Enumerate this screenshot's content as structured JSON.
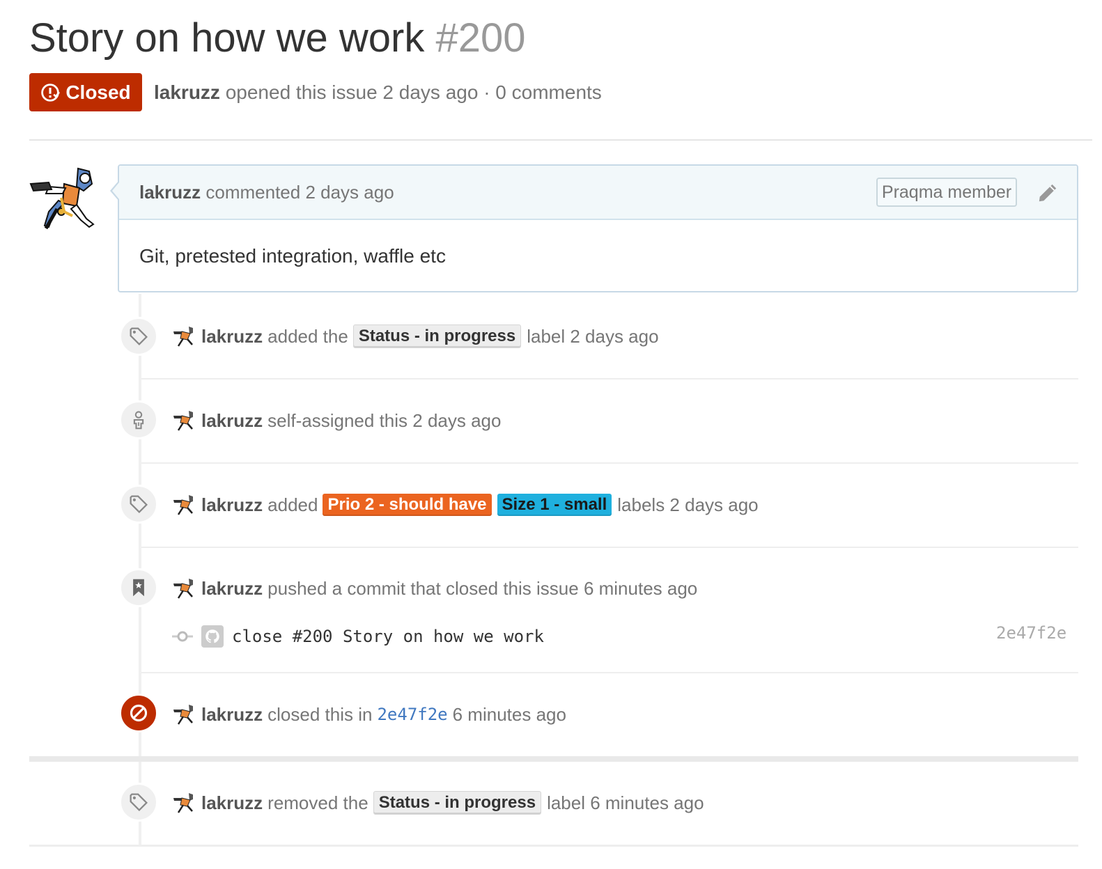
{
  "issue": {
    "title": "Story on how we work",
    "number": "#200",
    "state": "Closed",
    "author": "lakruzz",
    "opened_text": "opened this issue 2 days ago · 0 comments"
  },
  "comment": {
    "author": "lakruzz",
    "action": "commented 2 days ago",
    "role_badge": "Praqma member",
    "body": "Git, pretested integration, waffle etc"
  },
  "timeline": {
    "event1": {
      "author": "lakruzz",
      "before": "added the",
      "label": "Status - in progress",
      "after": "label 2 days ago"
    },
    "event2": {
      "author": "lakruzz",
      "text": "self-assigned this 2 days ago"
    },
    "event3": {
      "author": "lakruzz",
      "before": "added",
      "label1": "Prio 2 - should have",
      "label2": "Size 1 - small",
      "after": "labels 2 days ago"
    },
    "event4": {
      "author": "lakruzz",
      "text": "pushed a commit that closed this issue 6 minutes ago",
      "commit_message": "close #200 Story on how we work",
      "commit_sha": "2e47f2e"
    },
    "event5": {
      "author": "lakruzz",
      "before": "closed this in",
      "sha": "2e47f2e",
      "after": "6 minutes ago"
    },
    "event6": {
      "author": "lakruzz",
      "before": "removed the",
      "label": "Status - in progress",
      "after": "label 6 minutes ago"
    }
  },
  "colors": {
    "closed_red": "#bd2c00",
    "label_gray": "#ededed",
    "label_orange": "#eb6420",
    "label_blue": "#1fb0de",
    "link_blue": "#4078c0"
  },
  "icons": [
    "issue-closed-icon",
    "pencil-icon",
    "tag-icon",
    "person-icon",
    "bookmark-icon",
    "git-commit-icon",
    "github-icon",
    "circle-slash-icon"
  ]
}
